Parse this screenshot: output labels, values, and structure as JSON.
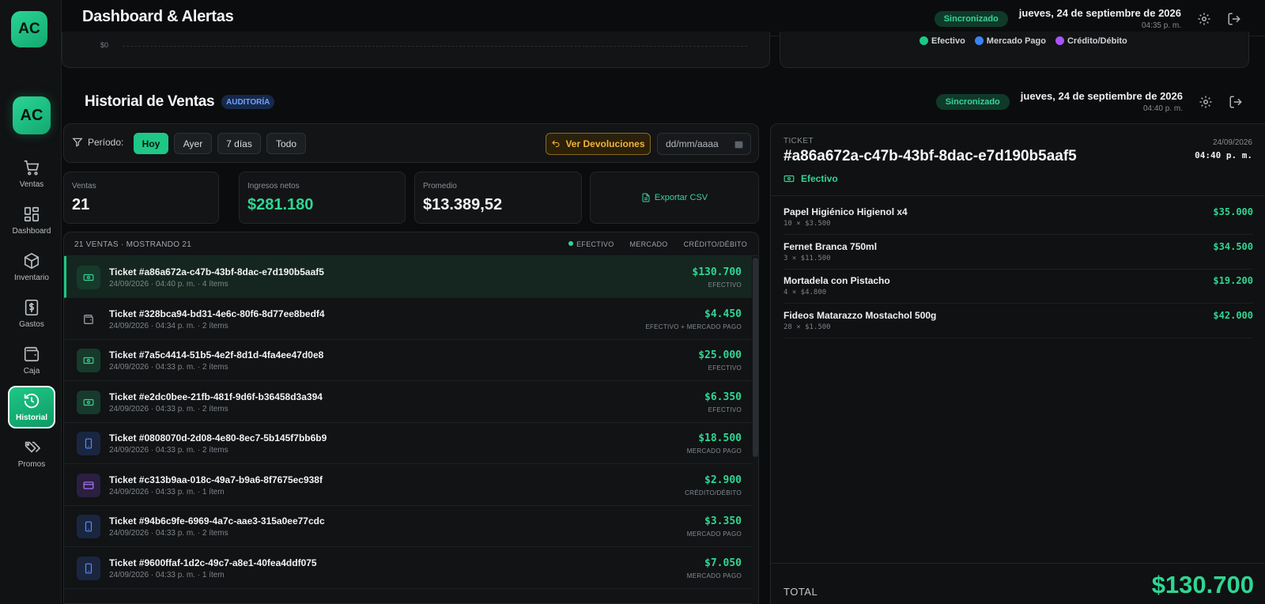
{
  "background_layer": {
    "logo": "AC",
    "title": "Dashboard & Alertas",
    "sync": "Sincronizado",
    "date": "jueves, 24 de septiembre de 2026",
    "time": "04:35 p. m.",
    "chart_zero_label": "$0",
    "legend": [
      {
        "label": "Efectivo",
        "color": "#1ec786"
      },
      {
        "label": "Mercado Pago",
        "color": "#3b82f6"
      },
      {
        "label": "Crédito/Débito",
        "color": "#a855f7"
      }
    ]
  },
  "sidebar": {
    "logo": "AC",
    "items": [
      {
        "label": "Ventas",
        "icon": "cart-icon"
      },
      {
        "label": "Dashboard",
        "icon": "grid-icon"
      },
      {
        "label": "Inventario",
        "icon": "box-icon"
      },
      {
        "label": "Gastos",
        "icon": "dollar-icon"
      },
      {
        "label": "Caja",
        "icon": "wallet-icon"
      },
      {
        "label": "Historial",
        "icon": "history-icon",
        "active": true
      },
      {
        "label": "Promos",
        "icon": "tags-icon"
      }
    ]
  },
  "header": {
    "title": "Historial de Ventas",
    "badge": "AUDITORÍA",
    "sync": "Sincronizado",
    "date": "jueves, 24 de septiembre de 2026",
    "time": "04:40 p. m."
  },
  "filters": {
    "label": "Período:",
    "options": [
      "Hoy",
      "Ayer",
      "7 días",
      "Todo"
    ],
    "selected": "Hoy",
    "returns_button": "Ver Devoluciones",
    "date_placeholder": "dd/mm/aaaa"
  },
  "stats": {
    "sales_label": "Ventas",
    "sales_value": "21",
    "net_label": "Ingresos netos",
    "net_value": "$281.180",
    "avg_label": "Promedio",
    "avg_value": "$13.389,52",
    "export_label": "Exportar CSV"
  },
  "list": {
    "count_text": "21 VENTAS · MOSTRANDO 21",
    "legend": [
      "EFECTIVO",
      "MERCADO",
      "CRÉDITO/DÉBITO"
    ],
    "rows": [
      {
        "title": "Ticket #a86a672a-c47b-43bf-8dac-e7d190b5aaf5",
        "meta": "24/09/2026 · 04:40 p. m. · 4 ítems",
        "amount": "$130.700",
        "payment": "EFECTIVO",
        "type": "cash",
        "selected": true
      },
      {
        "title": "Ticket #328bca94-bd31-4e6c-80f6-8d77ee8bedf4",
        "meta": "24/09/2026 · 04:34 p. m. · 2 ítems",
        "amount": "$4.450",
        "payment": "EFECTIVO + MERCADO PAGO",
        "type": "mix"
      },
      {
        "title": "Ticket #7a5c4414-51b5-4e2f-8d1d-4fa4ee47d0e8",
        "meta": "24/09/2026 · 04:33 p. m. · 2 ítems",
        "amount": "$25.000",
        "payment": "EFECTIVO",
        "type": "cash"
      },
      {
        "title": "Ticket #e2dc0bee-21fb-481f-9d6f-b36458d3a394",
        "meta": "24/09/2026 · 04:33 p. m. · 2 ítems",
        "amount": "$6.350",
        "payment": "EFECTIVO",
        "type": "cash"
      },
      {
        "title": "Ticket #0808070d-2d08-4e80-8ec7-5b145f7bb6b9",
        "meta": "24/09/2026 · 04:33 p. m. · 2 ítems",
        "amount": "$18.500",
        "payment": "MERCADO PAGO",
        "type": "mp"
      },
      {
        "title": "Ticket #c313b9aa-018c-49a7-b9a6-8f7675ec938f",
        "meta": "24/09/2026 · 04:33 p. m. · 1 ítem",
        "amount": "$2.900",
        "payment": "CRÉDITO/DÉBITO",
        "type": "cred"
      },
      {
        "title": "Ticket #94b6c9fe-6969-4a7c-aae3-315a0ee77cdc",
        "meta": "24/09/2026 · 04:33 p. m. · 2 ítems",
        "amount": "$3.350",
        "payment": "MERCADO PAGO",
        "type": "mp"
      },
      {
        "title": "Ticket #9600ffaf-1d2c-49c7-a8e1-40fea4ddf075",
        "meta": "24/09/2026 · 04:33 p. m. · 1 ítem",
        "amount": "$7.050",
        "payment": "MERCADO PAGO",
        "type": "mp"
      }
    ]
  },
  "detail": {
    "label": "TICKET",
    "id": "#a86a672a-c47b-43bf-8dac-e7d190b5aaf5",
    "date": "24/09/2026",
    "time": "04:40 p. m.",
    "payment": "Efectivo",
    "items": [
      {
        "name": "Papel Higiénico Higienol x4",
        "qty": "10 × $3.500",
        "price": "$35.000"
      },
      {
        "name": "Fernet Branca 750ml",
        "qty": "3 × $11.500",
        "price": "$34.500"
      },
      {
        "name": "Mortadela con Pistacho",
        "qty": "4 × $4.800",
        "price": "$19.200"
      },
      {
        "name": "Fideos Matarazzo Mostachol 500g",
        "qty": "28 × $1.500",
        "price": "$42.000"
      }
    ],
    "total_label": "TOTAL",
    "total_value": "$130.700"
  },
  "colors": {
    "accent": "#1ec786",
    "mercado_pago": "#3b82f6",
    "credit": "#a855f7",
    "warning": "#f0b43b"
  }
}
